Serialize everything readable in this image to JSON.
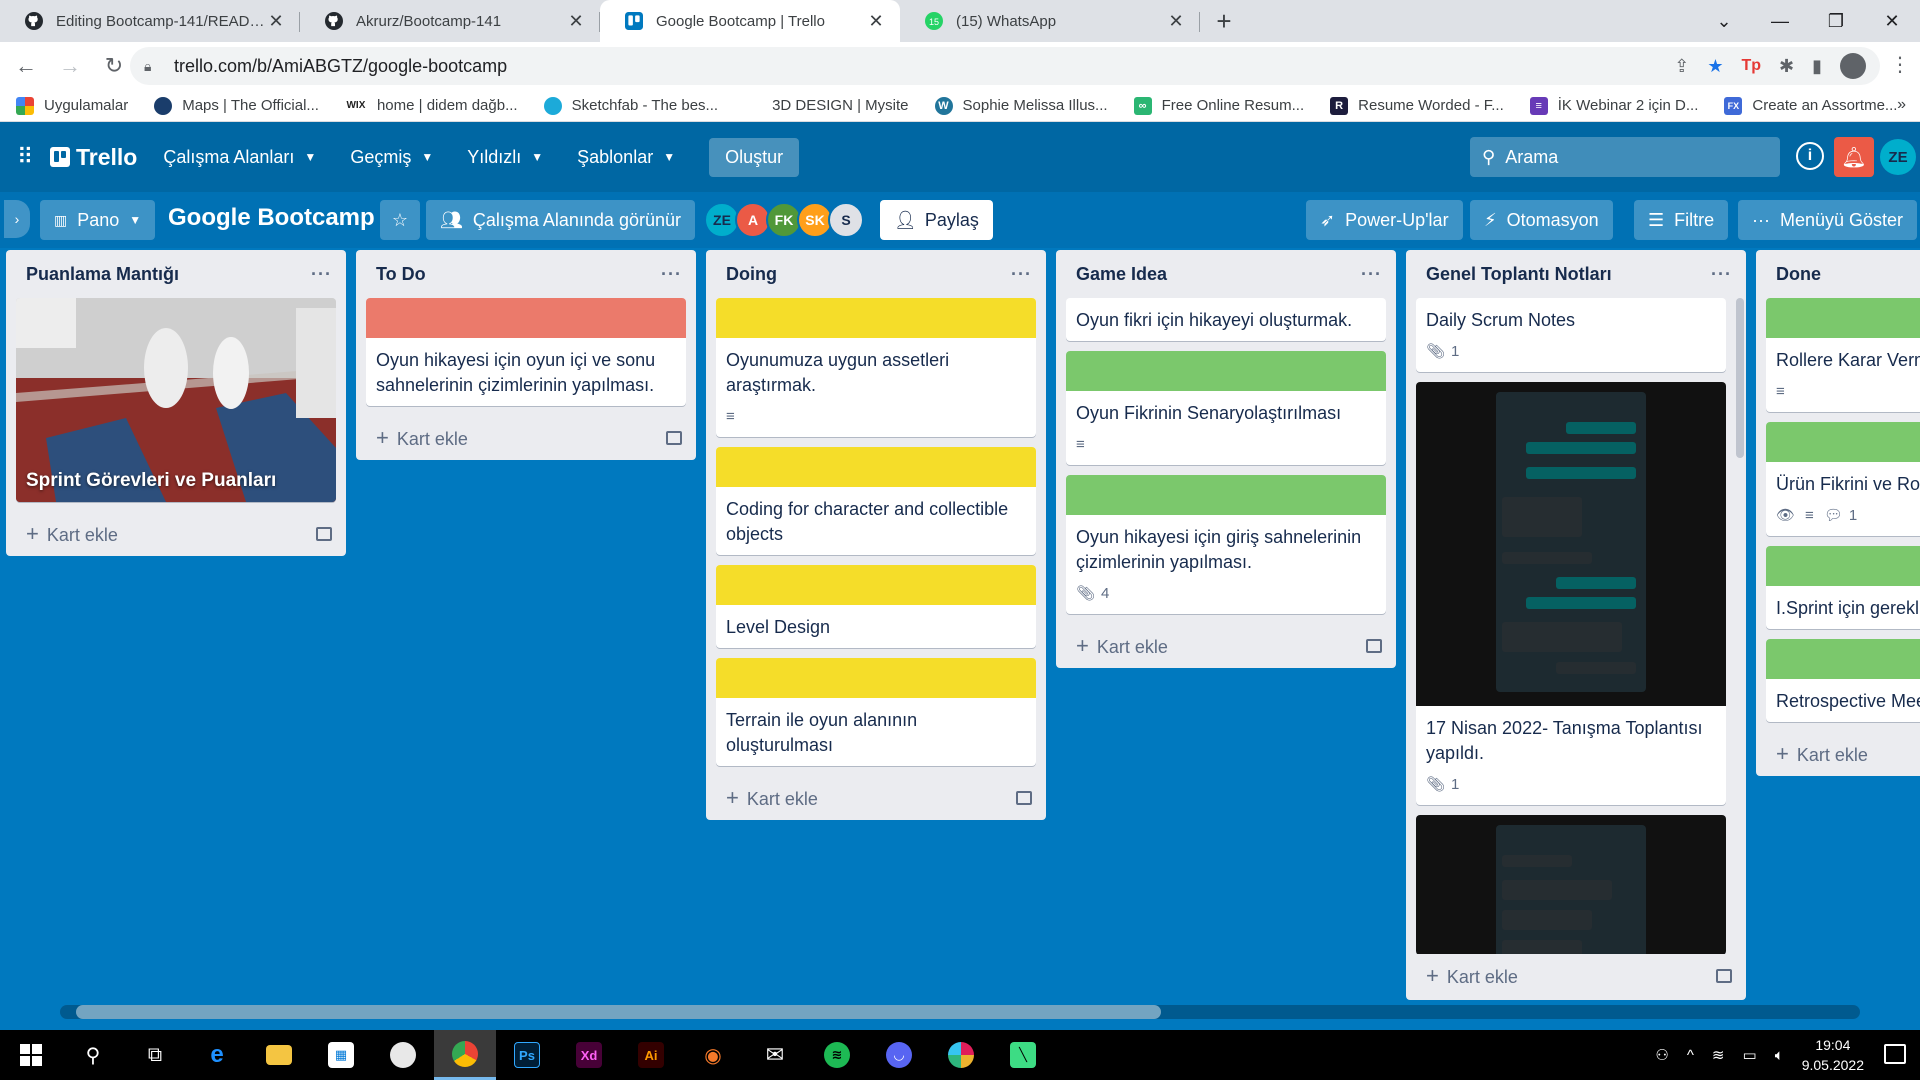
{
  "browser": {
    "tabs": [
      {
        "title": "Editing Bootcamp-141/README.",
        "icon": "github-icon"
      },
      {
        "title": "Akrurz/Bootcamp-141",
        "icon": "github-icon"
      },
      {
        "title": "Google Bootcamp | Trello",
        "icon": "trello-icon"
      },
      {
        "title": "(15) WhatsApp",
        "icon": "whatsapp-icon",
        "badge": "15"
      }
    ],
    "url": "trello.com/b/AmiABGTZ/google-bootcamp",
    "bookmarks": [
      {
        "label": "Uygulamalar",
        "color": "#ea4335"
      },
      {
        "label": "Maps | The Official...",
        "color": "#1a3d6b"
      },
      {
        "label": "home | didem dağb...",
        "color": "#222222",
        "prefix": "WIX"
      },
      {
        "label": "Sketchfab - The bes...",
        "color": "#1caad9"
      },
      {
        "label": "3D DESIGN | Mysite",
        "color": "#ffffff"
      },
      {
        "label": "Sophie Melissa Illus...",
        "color": "#21759b"
      },
      {
        "label": "Free Online Resum...",
        "color": "#2bb673"
      },
      {
        "label": "Resume Worded - F...",
        "color": "#1d1d3d"
      },
      {
        "label": "İK Webinar 2 için D...",
        "color": "#673ab7"
      },
      {
        "label": "Create an Assortme...",
        "color": "#3f6ad8"
      }
    ]
  },
  "trello": {
    "nav": {
      "workspaces": "Çalışma Alanları",
      "recent": "Geçmiş",
      "starred": "Yıldızlı",
      "templates": "Şablonlar",
      "create": "Oluştur",
      "search_placeholder": "Arama",
      "user_initials": "ZE"
    },
    "board": {
      "view": "Pano",
      "title": "Google Bootcamp",
      "visibility": "Çalışma Alanında görünür",
      "members": [
        {
          "initials": "ZE",
          "color": "#00aecc"
        },
        {
          "initials": "A",
          "color": "#eb5a46"
        },
        {
          "initials": "FK",
          "color": "#519839"
        },
        {
          "initials": "SK",
          "color": "#ff9f1a"
        },
        {
          "initials": "S",
          "color": "#dfe1e6"
        }
      ],
      "share": "Paylaş",
      "powerups": "Power-Up'lar",
      "automation": "Otomasyon",
      "filter": "Filtre",
      "show_menu": "Menüyü Göster"
    },
    "add_card": "Kart ekle",
    "lists": [
      {
        "title": "Puanlama Mantığı",
        "image_card_title": "Sprint Görevleri ve Puanları"
      },
      {
        "title": "To Do",
        "cards": [
          {
            "cover": "#eb7a6b",
            "text": "Oyun hikayesi için oyun içi ve sonu sahnelerinin çizimlerinin yapılması."
          }
        ]
      },
      {
        "title": "Doing",
        "cards": [
          {
            "cover": "#f5dd29",
            "text": "Oyunumuza uygun assetleri araştırmak.",
            "description": true
          },
          {
            "cover": "#f5dd29",
            "text": "Coding for character and collectible objects"
          },
          {
            "cover": "#f5dd29",
            "text": "Level Design"
          },
          {
            "cover": "#f5dd29",
            "text": "Terrain ile oyun alanının oluşturulması"
          }
        ]
      },
      {
        "title": "Game Idea",
        "cards": [
          {
            "cover": "",
            "text": "Oyun fikri için hikayeyi oluşturmak."
          },
          {
            "cover": "#7bc86c",
            "text": "Oyun Fikrinin Senaryolaştırılması",
            "description": true
          },
          {
            "cover": "#7bc86c",
            "text": "Oyun hikayesi için giriş sahnelerinin çizimlerinin yapılması.",
            "attachments": "4"
          }
        ]
      },
      {
        "title": "Genel Toplantı Notları",
        "cards": [
          {
            "text": "Daily Scrum Notes",
            "attachments": "1"
          },
          {
            "text": "17 Nisan 2022- Tanışma Toplantısı yapıldı.",
            "attachments": "1",
            "image": true
          }
        ]
      },
      {
        "title": "Done",
        "cards": [
          {
            "cover": "#7bc86c",
            "text": "Rollere Karar Verme",
            "description": true
          },
          {
            "cover": "#7bc86c",
            "text": "Ürün Fikrini ve Roll",
            "watch": true,
            "description": true,
            "comments": "1"
          },
          {
            "cover": "#7bc86c",
            "text": "I.Sprint için gerekli etmek."
          },
          {
            "cover": "#7bc86c",
            "text": "Retrospective Meet"
          }
        ]
      }
    ]
  },
  "taskbar": {
    "time": "19:04",
    "date": "9.05.2022"
  }
}
